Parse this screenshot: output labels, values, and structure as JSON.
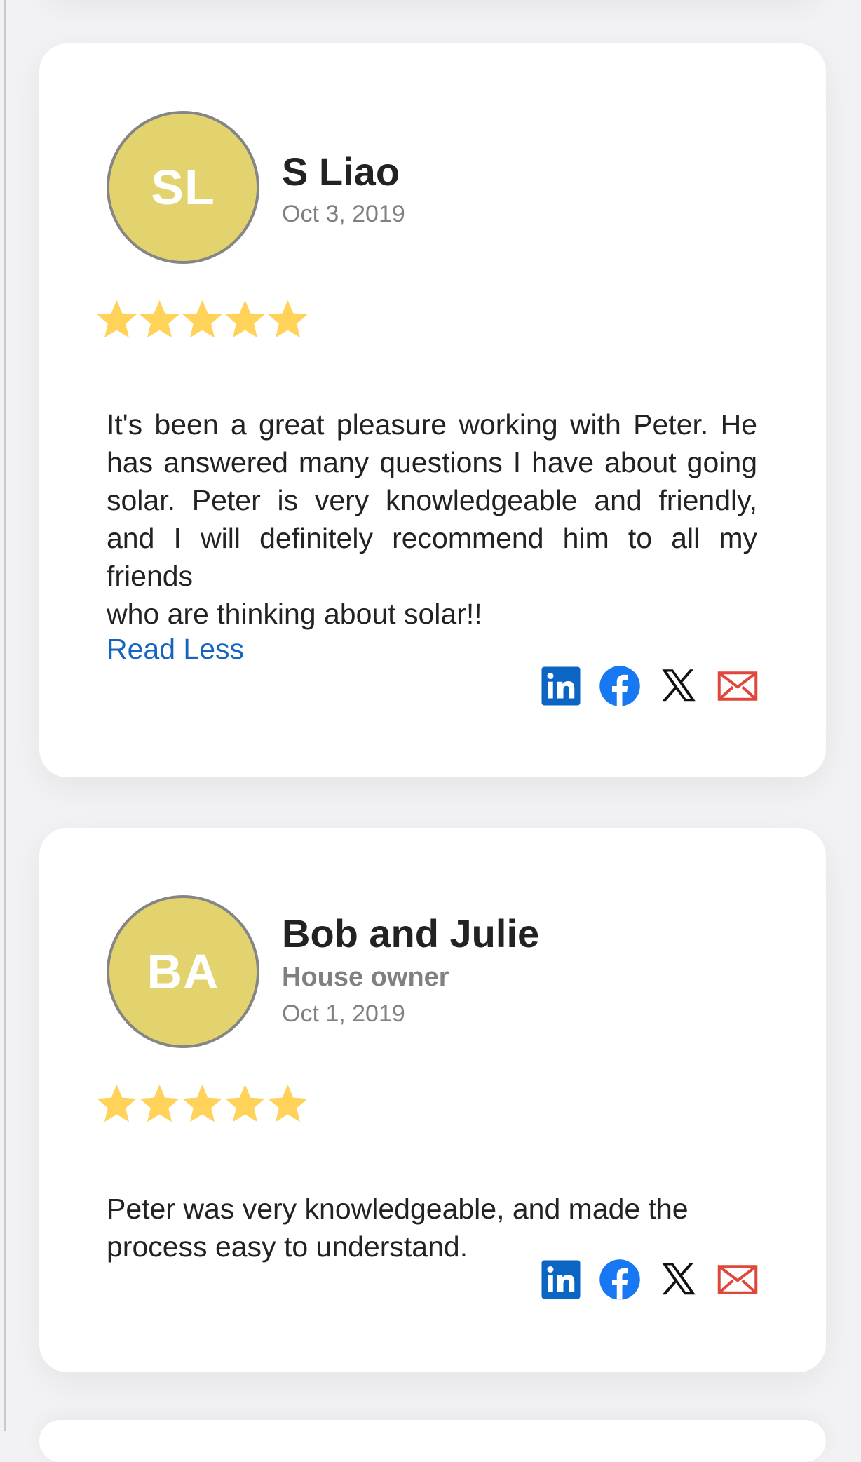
{
  "reviews": [
    {
      "initials": "SL",
      "name": "S Liao",
      "date": "Oct 3, 2019",
      "rating": 5,
      "text_justified": "It's been a great pleasure working with Peter. He has answered many questions I have about going solar. Peter is very knowledgeable and friendly, and I will definitely recommend him to all my friends",
      "text_last_line": "who are thinking about solar!!",
      "read_less_label": "Read Less"
    },
    {
      "initials": "BA",
      "name": "Bob and Julie",
      "role": "House owner",
      "date": "Oct 1, 2019",
      "rating": 5,
      "text_justified": "Peter was very knowledgeable, and made the",
      "text_last_line": "process easy to understand."
    }
  ],
  "share_icons": [
    "linkedin-icon",
    "facebook-icon",
    "x-icon",
    "email-icon"
  ],
  "colors": {
    "avatar_bg": "#e3d36f",
    "star": "#ffd25a",
    "link": "#1565c0",
    "linkedin": "#0a66c2",
    "facebook": "#1877f2",
    "email": "#e0463a"
  }
}
